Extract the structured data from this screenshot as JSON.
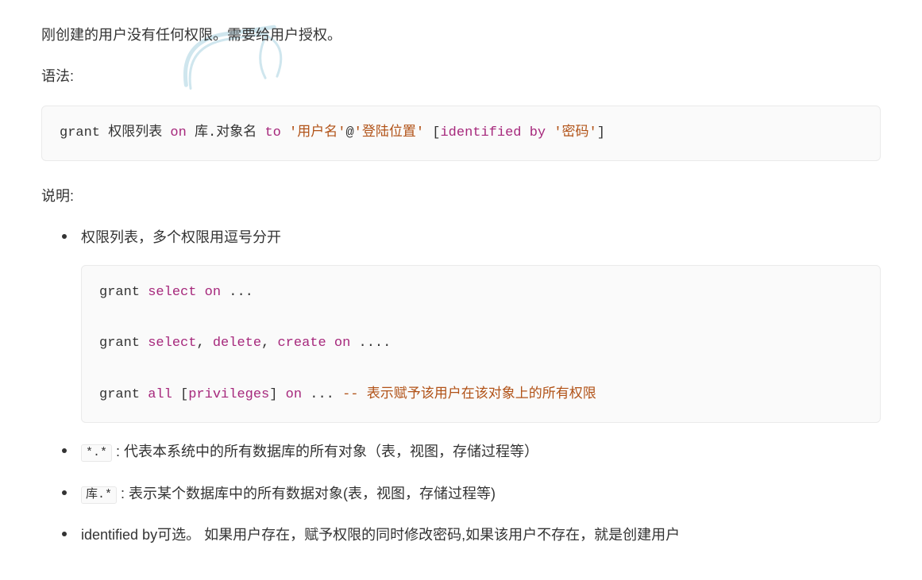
{
  "intro1": "刚创建的用户没有任何权限。需要给用户授权。",
  "intro2": "语法:",
  "code1": {
    "grant": "grant",
    "privlist": " 权限列表 ",
    "on": "on",
    "dbobj": " 库.对象名 ",
    "to": "to",
    "sp": " ",
    "q1": "'用户名'",
    "at": "@",
    "q2": "'登陆位置'",
    "sp2": " [",
    "ident": "identified",
    "sp3": " ",
    "by": "by",
    "sp4": " ",
    "q3": "'密码'",
    "close": "]"
  },
  "explain_label": "说明:",
  "bullets": [
    {
      "text": "权限列表，多个权限用逗号分开"
    },
    {
      "code_prefix": "*.*",
      "text": " : 代表本系统中的所有数据库的所有对象（表，视图，存储过程等）"
    },
    {
      "code_prefix": "库.*",
      "text": " : 表示某个数据库中的所有数据对象(表，视图，存储过程等)"
    },
    {
      "text": "identified by可选。 如果用户存在，赋予权限的同时修改密码,如果该用户不存在，就是创建用户"
    }
  ],
  "code2": {
    "l1": {
      "grant": "grant ",
      "kw": "select",
      "on": " on",
      "tail": " ..."
    },
    "l2": {
      "grant": "grant ",
      "kw1": "select",
      "c1": ", ",
      "kw2": "delete",
      "c2": ", ",
      "kw3": "create",
      "on": " on",
      "tail": " ...."
    },
    "l3": {
      "grant": "grant ",
      "all": "all",
      "sp": " [",
      "priv": "privileges",
      "close": "] ",
      "on": "on",
      "tail": " ... ",
      "dashes": "-- ",
      "comment": "表示赋予该用户在该对象上的所有权限"
    }
  }
}
